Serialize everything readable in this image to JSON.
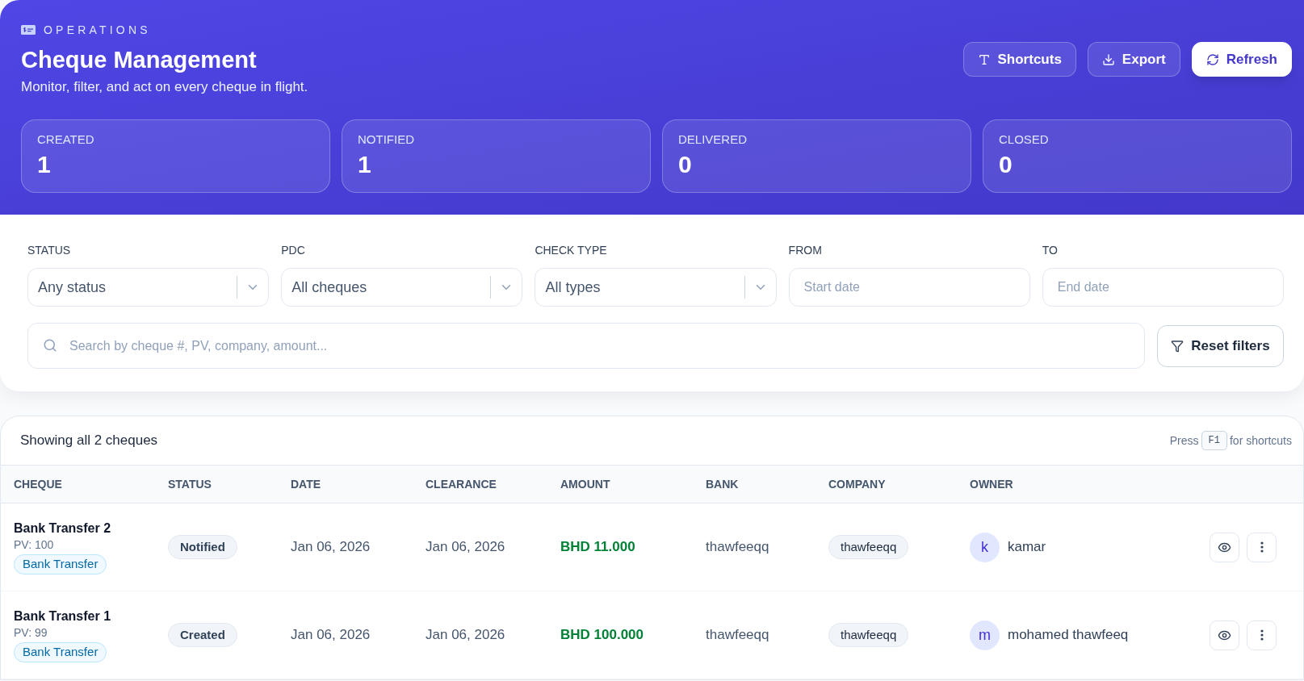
{
  "header": {
    "eyebrow": "OPERATIONS",
    "title": "Cheque Management",
    "subtitle": "Monitor, filter, and act on every cheque in flight.",
    "actions": [
      {
        "kind": "shortcuts",
        "label": "Shortcuts"
      },
      {
        "kind": "export",
        "label": "Export"
      },
      {
        "kind": "refresh",
        "label": "Refresh"
      }
    ]
  },
  "stats": [
    {
      "label": "CREATED",
      "value": "1"
    },
    {
      "label": "NOTIFIED",
      "value": "1"
    },
    {
      "label": "DELIVERED",
      "value": "0"
    },
    {
      "label": "CLOSED",
      "value": "0"
    }
  ],
  "filters": {
    "fields": [
      {
        "kind": "select",
        "label": "STATUS",
        "value": "Any status"
      },
      {
        "kind": "select",
        "label": "PDC",
        "value": "All cheques"
      },
      {
        "kind": "select",
        "label": "CHECK TYPE",
        "value": "All types"
      },
      {
        "kind": "date",
        "label": "FROM",
        "placeholder": "Start date"
      },
      {
        "kind": "date",
        "label": "TO",
        "placeholder": "End date"
      }
    ],
    "search": {
      "placeholder": "Search by cheque #, PV, company, amount..."
    },
    "reset_button": "Reset filters"
  },
  "table": {
    "summary": "Showing all 2 cheques",
    "shortcut_hint": {
      "before": "Press",
      "key": "F1",
      "after": "for shortcuts"
    },
    "columns": [
      "CHEQUE",
      "STATUS",
      "DATE",
      "CLEARANCE",
      "AMOUNT",
      "BANK",
      "COMPANY",
      "OWNER"
    ],
    "rows": [
      {
        "name": "Bank Transfer 2",
        "pv": "PV: 100",
        "type": "Bank Transfer",
        "status": "Notified",
        "date": "Jan 06, 2026",
        "clearance": "Jan 06, 2026",
        "amount": "BHD 11.000",
        "bank": "thawfeeqq",
        "company": "thawfeeqq",
        "owner": {
          "initial": "k",
          "name": "kamar"
        }
      },
      {
        "name": "Bank Transfer 1",
        "pv": "PV: 99",
        "type": "Bank Transfer",
        "status": "Created",
        "date": "Jan 06, 2026",
        "clearance": "Jan 06, 2026",
        "amount": "BHD 100.000",
        "bank": "thawfeeqq",
        "company": "thawfeeqq",
        "owner": {
          "initial": "m",
          "name": "mohamed thawfeeq"
        }
      }
    ]
  }
}
